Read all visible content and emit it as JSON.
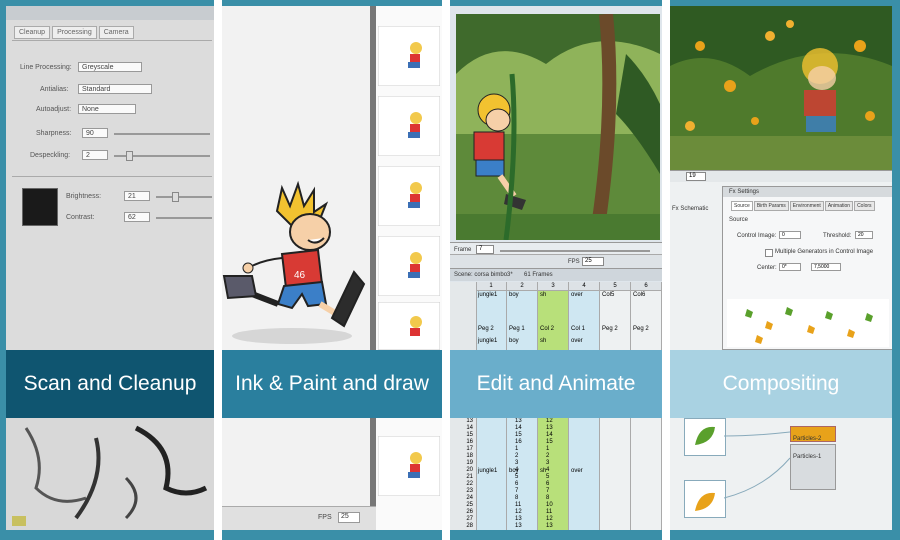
{
  "panels": [
    {
      "banner": "Scan and Cleanup",
      "banner_color": "#0f5570",
      "tabs": [
        "Cleanup",
        "Processing",
        "Camera"
      ],
      "fields": {
        "line_processing_label": "Line Processing:",
        "line_processing_value": "Greyscale",
        "antialias_label": "Antialias:",
        "antialias_value": "Standard",
        "autoadjust_label": "Autoadjust:",
        "autoadjust_value": "None",
        "sharpness_label": "Sharpness:",
        "sharpness_value": "90",
        "despeckling_label": "Despeckling:",
        "despeckling_value": "2",
        "brightness_label": "Brightness:",
        "brightness_value": "21",
        "contrast_label": "Contrast:",
        "contrast_value": "62"
      }
    },
    {
      "banner": "Ink & Paint and draw",
      "banner_color": "#2a7f9e",
      "footer_fps_label": "FPS",
      "footer_fps_value": "25"
    },
    {
      "banner": "Edit and Animate",
      "banner_color": "#6aaecb",
      "frame_label": "Frame",
      "frame_value": "7",
      "fps_label": "FPS",
      "fps_value": "25",
      "scene_title": "Scene: corsa bimbo3*",
      "frames_count": "61 Frames",
      "column_numbers": [
        "1",
        "2",
        "3",
        "4",
        "5",
        "6"
      ],
      "columns": [
        "jungle1",
        "boy",
        "sh",
        "over",
        "Col5",
        "Col6"
      ],
      "pegs": [
        "Peg 2",
        "Peg 1",
        "Col 2",
        "Col 1",
        "Peg 2",
        "Peg 2"
      ],
      "rows": [
        [
          "13",
          "13",
          "12"
        ],
        [
          "14",
          "14",
          "13"
        ],
        [
          "15",
          "15",
          "14"
        ],
        [
          "16",
          "16",
          "15"
        ],
        [
          "17",
          "1",
          "1"
        ],
        [
          "18",
          "2",
          "2"
        ],
        [
          "19",
          "3",
          "3"
        ],
        [
          "20",
          "4",
          "4"
        ],
        [
          "21",
          "5",
          "5"
        ],
        [
          "22",
          "6",
          "6"
        ],
        [
          "23",
          "7",
          "7"
        ],
        [
          "24",
          "8",
          "8"
        ],
        [
          "25",
          "11",
          "10"
        ],
        [
          "26",
          "12",
          "11"
        ],
        [
          "27",
          "13",
          "12"
        ],
        [
          "28",
          "13",
          "13"
        ]
      ],
      "row_labels": [
        "jungle1",
        "boy",
        "sh",
        "over"
      ]
    },
    {
      "banner": "Compositing",
      "banner_color": "#a9d2e2",
      "frame_value": "19",
      "fx_schematic_label": "Fx Schematic",
      "fx_settings_title": "Fx Settings",
      "fx_tabs": [
        "Source",
        "Birth Params",
        "Environment",
        "Animation",
        "Colors"
      ],
      "source_label": "Source",
      "control_image_label": "Control Image:",
      "control_image_value": "0",
      "threshold_label": "Threshold:",
      "threshold_value": "20",
      "multiple_label": "Multiple Generators in Control Image",
      "center_label": "Center:",
      "center_x": "0*",
      "center_y": "7,5000",
      "node_label": "Particles-2",
      "node2_label": "Particles-1"
    }
  ]
}
